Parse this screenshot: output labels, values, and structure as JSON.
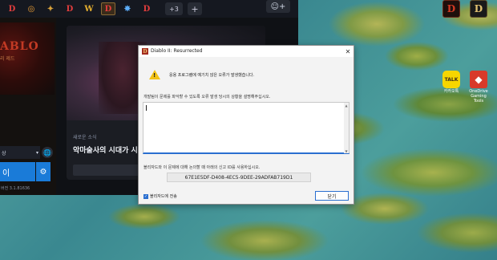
{
  "launcher": {
    "games": [
      {
        "name": "diablo-iv",
        "label": "D"
      },
      {
        "name": "overwatch",
        "label": "◎"
      },
      {
        "name": "hearthstone",
        "label": "✦"
      },
      {
        "name": "diablo-iii",
        "label": "D"
      },
      {
        "name": "world-of-warcraft",
        "label": "W"
      },
      {
        "name": "diablo-ii-resurrected",
        "label": "D"
      },
      {
        "name": "starcraft",
        "label": "✵"
      },
      {
        "name": "diablo-immortal",
        "label": "D"
      }
    ],
    "more_label": "+3",
    "add_label": "+",
    "friends_label": "☺+",
    "d2_logo_title": "ABLO",
    "d2_logo_sub": "리 제드",
    "region_label": "상",
    "play_label": "이",
    "version": "버전 3.1.81636",
    "news_kicker": "새로운 소식",
    "news_title": "악마술사의 시대가 시작되"
  },
  "desktop_icons": [
    {
      "name": "d2-shortcut-1",
      "label": "",
      "glyph": "D"
    },
    {
      "name": "d2-shortcut-2",
      "label": "",
      "glyph": "D"
    },
    {
      "name": "kakaotalk",
      "label": "카카오톡",
      "glyph": "TALK"
    },
    {
      "name": "onenote",
      "label": "OneDrive Gaming Tools",
      "glyph": "◆"
    }
  ],
  "dialog": {
    "title": "Diablo II: Resurrected",
    "message": "응용 프로그램에 예기치 않은 오류가 발생했습니다.",
    "prompt": "개발팀이 문제를 파악할 수 있도록 오류 발생 당시의 상황을 설명해주십시오.",
    "textarea_value": "",
    "id_label": "블리자드와 이 문제에 대해 논의할 때 아래의 신고 ID를 사용하십시오.",
    "report_id": "67E1E5DF-D408-4EC5-9DEE-29ADFAB719D1",
    "checkbox_label": "블리자드에 전송",
    "checkbox_checked": true,
    "ok_label": "닫기"
  }
}
